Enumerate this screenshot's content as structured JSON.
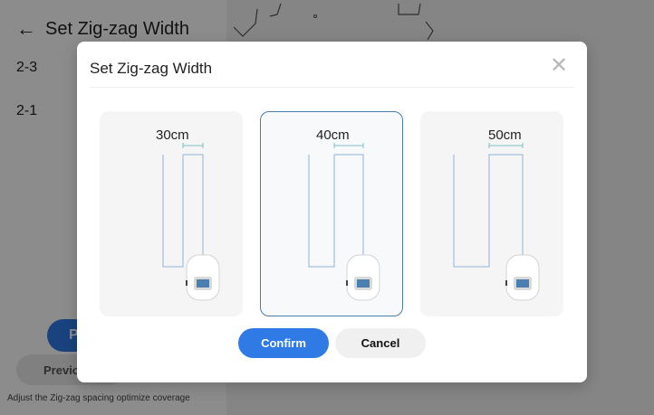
{
  "background": {
    "title": "Set Zig-zag Width",
    "zone_items": [
      {
        "label": "2-3"
      },
      {
        "label": "2-1"
      }
    ],
    "primary_button_partial": "P",
    "previous_button_partial": "Previo",
    "hint": "Adjust the Zig-zag spacing optimize coverage"
  },
  "dialog": {
    "title": "Set Zig-zag Width",
    "options": [
      {
        "label": "30cm",
        "selected": false
      },
      {
        "label": "40cm",
        "selected": true
      },
      {
        "label": "50cm",
        "selected": false
      }
    ],
    "confirm_label": "Confirm",
    "cancel_label": "Cancel"
  },
  "colors": {
    "accent": "#2f7ae5",
    "selected_border": "#4a7ea8",
    "path_line": "#8fb4d6",
    "width_marker": "#7fc0c8"
  },
  "icons": {
    "back": "arrow-left-icon",
    "close": "close-x-icon",
    "mower": "robot-mower-icon"
  }
}
